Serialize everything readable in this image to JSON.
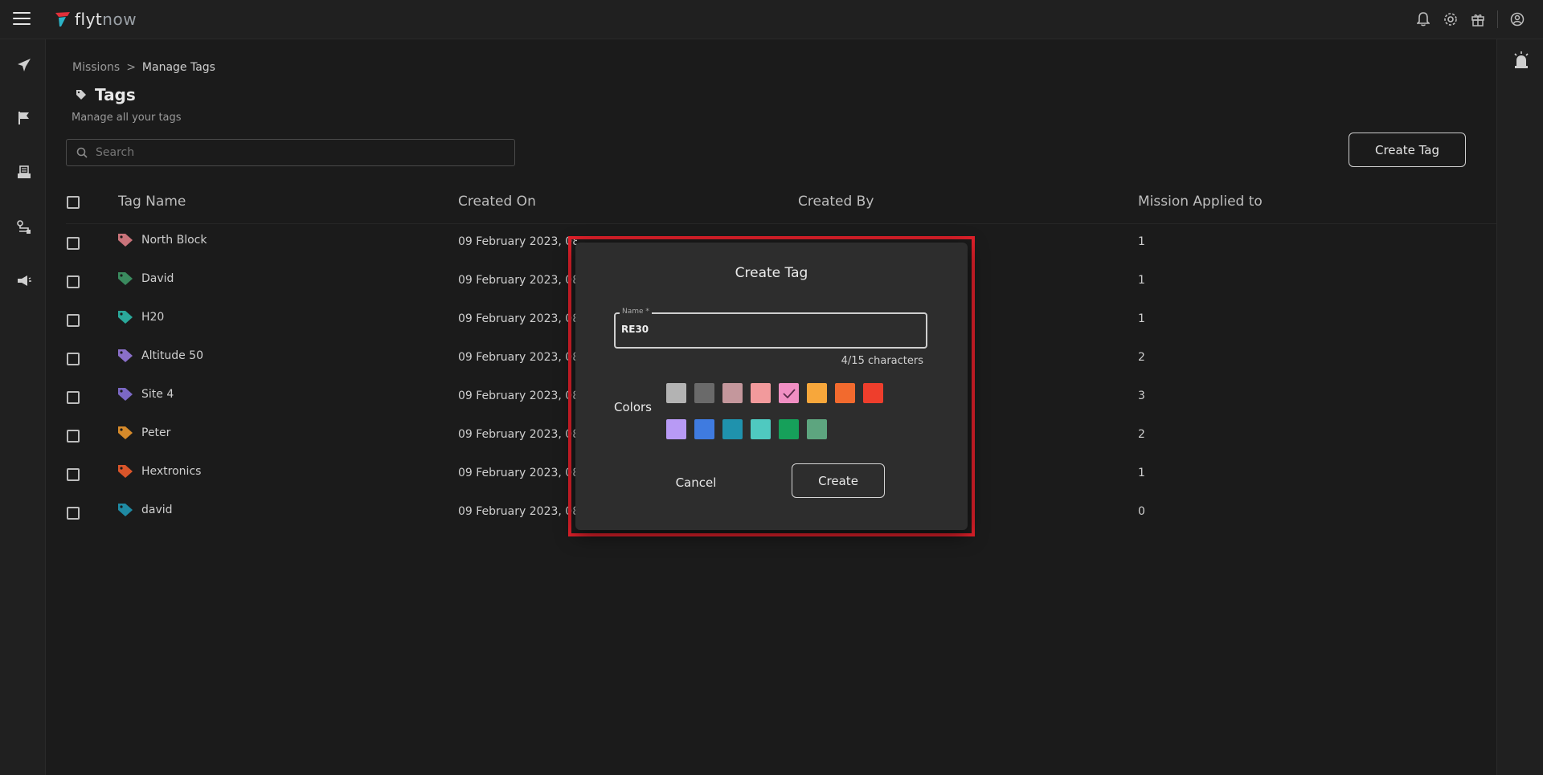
{
  "topbar": {
    "logo_brand": "flyt",
    "logo_suffix": "now",
    "icons": [
      "bell-icon",
      "gear-icon",
      "gift-icon",
      "user-circle-icon"
    ]
  },
  "sidebar": {
    "items": [
      "airplane-icon",
      "flag-icon",
      "printer-icon",
      "route-icon",
      "megaphone-icon"
    ]
  },
  "breadcrumb": {
    "parent": "Missions",
    "separator": ">",
    "current": "Manage Tags"
  },
  "page": {
    "title": "Tags",
    "subtitle": "Manage all your tags",
    "create_tag_label": "Create Tag"
  },
  "search": {
    "placeholder": "Search",
    "value": ""
  },
  "table": {
    "columns": [
      "Tag Name",
      "Created On",
      "Created By",
      "Mission Applied to"
    ],
    "rows": [
      {
        "name": "North Block",
        "color": "#c9737a",
        "created_on": "09 February 2023, 08:00 PM",
        "missions": "1"
      },
      {
        "name": "David",
        "color": "#3a8a5e",
        "created_on": "09 February 2023, 08:00 PM",
        "missions": "1"
      },
      {
        "name": "H20",
        "color": "#2aa89a",
        "created_on": "09 February 2023, 08:00 PM",
        "missions": "1"
      },
      {
        "name": "Altitude 50",
        "color": "#8a6fc9",
        "created_on": "09 February 2023, 08:00 PM",
        "missions": "2"
      },
      {
        "name": "Site 4",
        "color": "#7b68c4",
        "created_on": "09 February 2023, 08:00 PM",
        "missions": "3"
      },
      {
        "name": "Peter",
        "color": "#d68a2a",
        "created_on": "09 February 2023, 08:00 PM",
        "missions": "2"
      },
      {
        "name": "Hextronics",
        "color": "#d9552a",
        "created_on": "09 February 2023, 08:00 PM",
        "missions": "1"
      },
      {
        "name": "david",
        "color": "#1f8aa3",
        "created_on": "09 February 2023, 08:00 PM",
        "missions": "0"
      }
    ]
  },
  "modal": {
    "title": "Create Tag",
    "name_label": "Name *",
    "name_value": "RE30",
    "char_count": "4/15 characters",
    "colors_label": "Colors",
    "selected_index": 4,
    "colors": [
      "#b3b3b3",
      "#6a6a6a",
      "#c4979c",
      "#f29a9c",
      "#f08fc3",
      "#f7a73b",
      "#f26a2e",
      "#ee3e2c",
      "#b89af5",
      "#3f7be0",
      "#1f92ad",
      "#4fc9c0",
      "#16a05a",
      "#5da57f"
    ],
    "cancel_label": "Cancel",
    "create_label": "Create"
  }
}
